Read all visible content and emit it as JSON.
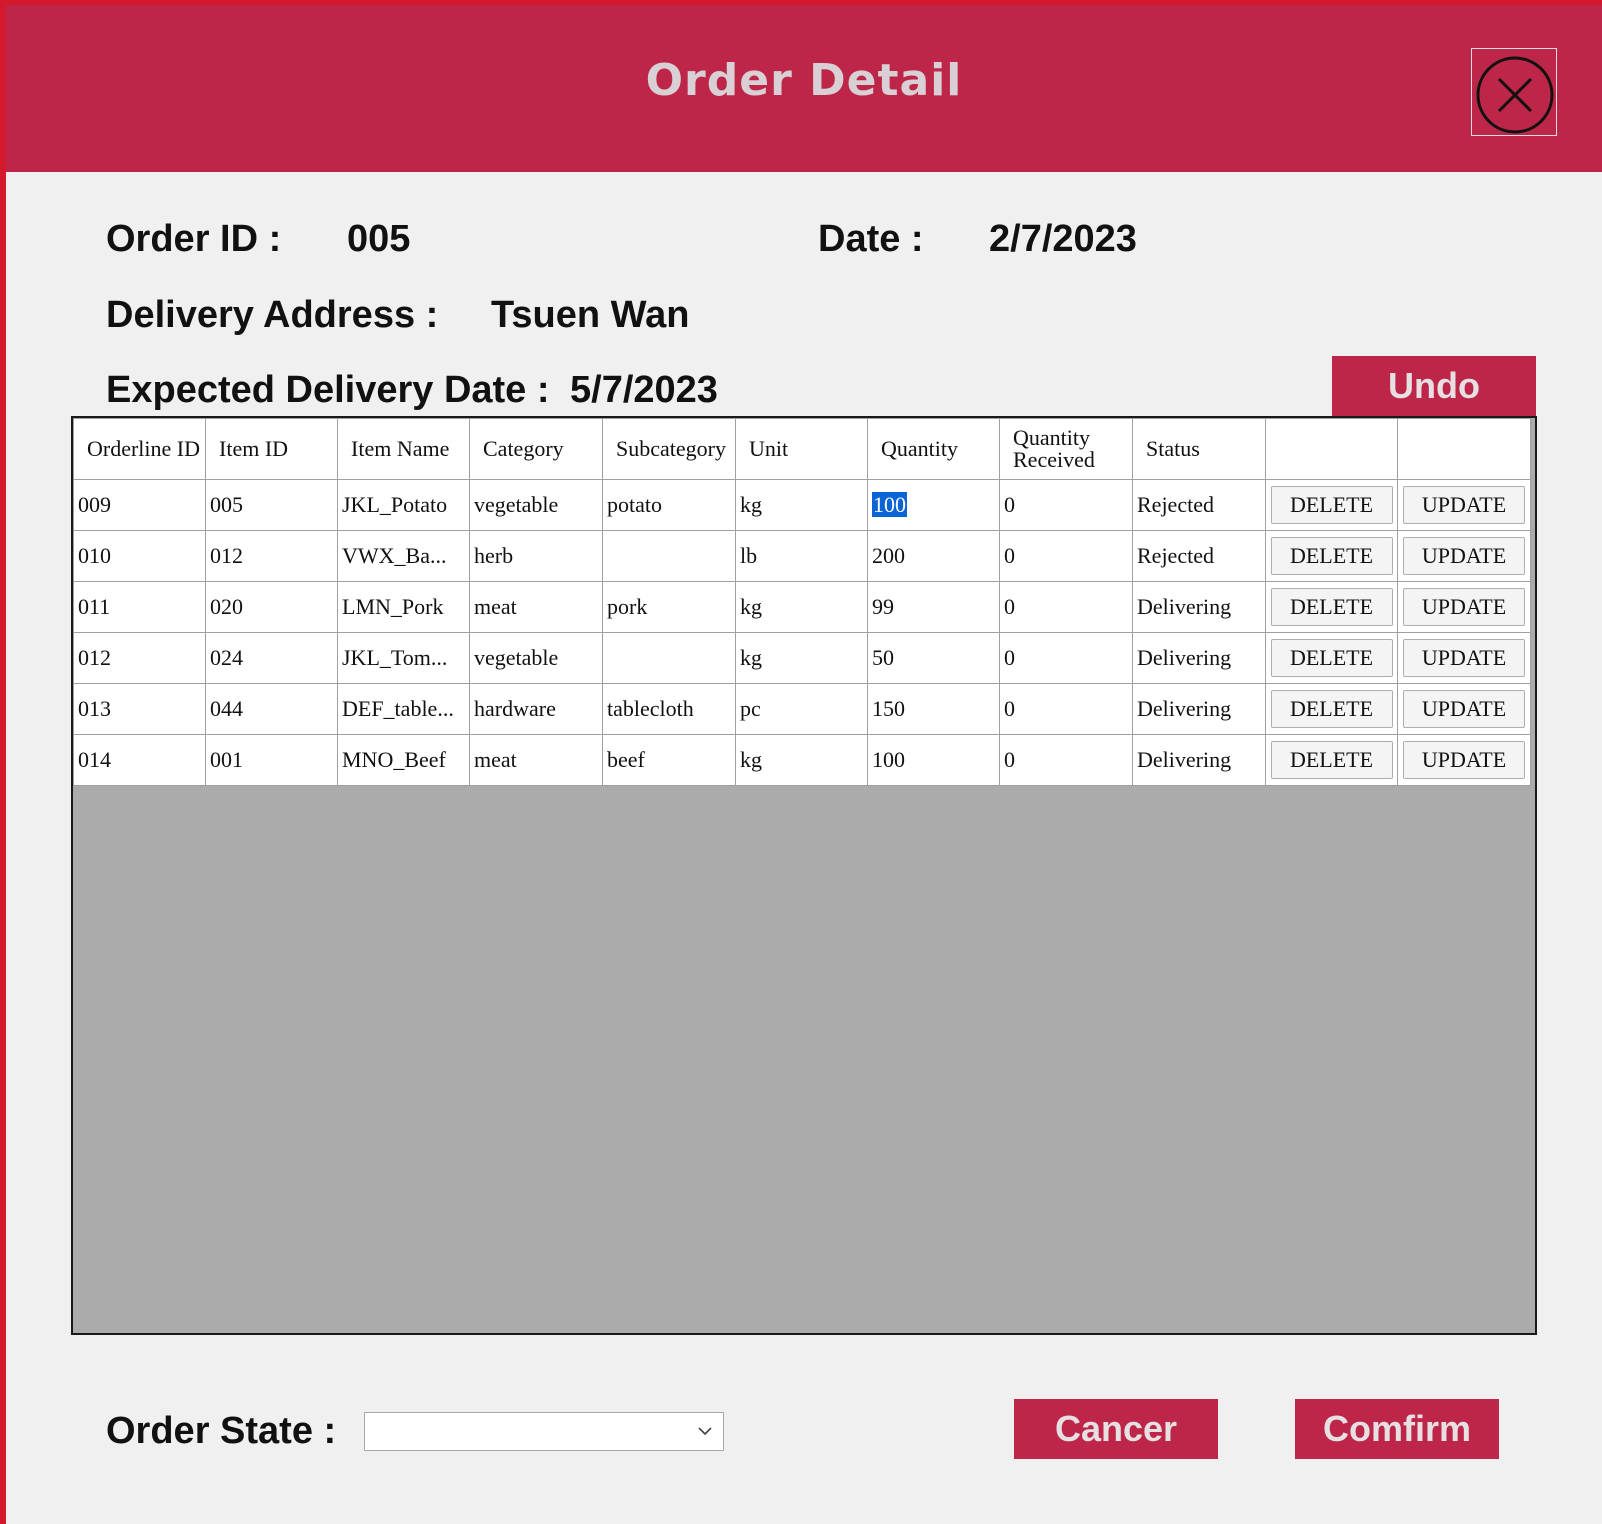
{
  "header": {
    "title": "Order Detail"
  },
  "order": {
    "id_label": "Order ID :",
    "id_value": "005",
    "date_label": "Date :",
    "date_value": "2/7/2023",
    "address_label": "Delivery Address :",
    "address_value": "Tsuen Wan",
    "expected_label": "Expected Delivery Date :",
    "expected_value": "5/7/2023"
  },
  "buttons": {
    "undo": "Undo",
    "cancel": "Cancer",
    "confirm": "Comfirm"
  },
  "grid": {
    "headers": [
      "Orderline ID",
      "Item ID",
      "Item Name",
      "Category",
      "Subcategory",
      "Unit",
      "Quantity",
      "Quantity Received",
      "Status",
      "",
      ""
    ],
    "delete_label": "DELETE",
    "update_label": "UPDATE",
    "rows": [
      [
        "009",
        "005",
        "JKL_Potato",
        "vegetable",
        "potato",
        "kg",
        "100",
        "0",
        "Rejected"
      ],
      [
        "010",
        "012",
        "VWX_Ba...",
        "herb",
        "",
        "lb",
        "200",
        "0",
        "Rejected"
      ],
      [
        "011",
        "020",
        "LMN_Pork",
        "meat",
        "pork",
        "kg",
        "99",
        "0",
        "Delivering"
      ],
      [
        "012",
        "024",
        "JKL_Tom...",
        "vegetable",
        "",
        "kg",
        "50",
        "0",
        "Delivering"
      ],
      [
        "013",
        "044",
        "DEF_table...",
        "hardware",
        "tablecloth",
        "pc",
        "150",
        "0",
        "Delivering"
      ],
      [
        "014",
        "001",
        "MNO_Beef",
        "meat",
        "beef",
        "kg",
        "100",
        "0",
        "Delivering"
      ]
    ]
  },
  "footer": {
    "order_state_label": "Order State :",
    "order_state_value": ""
  },
  "colors": {
    "accent": "#be2649",
    "frame": "#d4192d",
    "grid_empty": "#ababab",
    "selection": "#0a64d6"
  }
}
